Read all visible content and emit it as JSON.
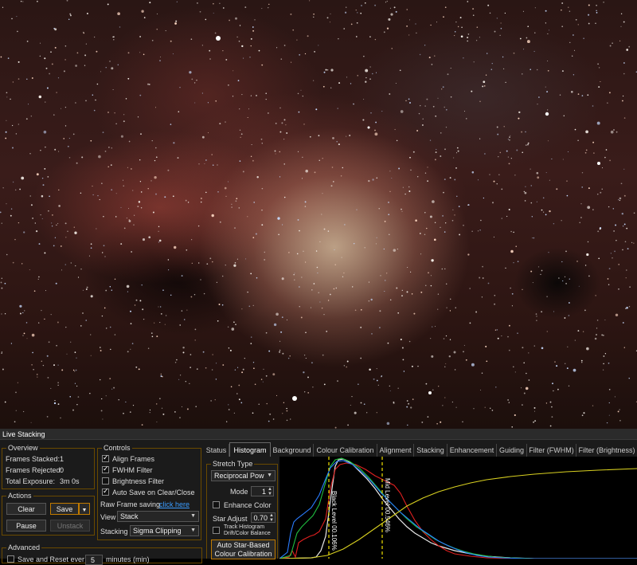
{
  "image": {
    "description_icon": "astro-image"
  },
  "window": {
    "title": "Live Stacking"
  },
  "overview": {
    "title": "Overview",
    "frames_stacked_label": "Frames Stacked:",
    "frames_stacked_value": "1",
    "frames_rejected_label": "Frames Rejected:",
    "frames_rejected_value": "0",
    "total_exposure_label": "Total Exposure:",
    "total_exposure_value": "3m 0s"
  },
  "actions": {
    "title": "Actions",
    "clear": "Clear",
    "save": "Save",
    "pause": "Pause",
    "unstack": "Unstack"
  },
  "advanced": {
    "title": "Advanced",
    "save_reset_label": "Save and Reset ever",
    "save_reset_value": "5",
    "save_reset_suffix": "minutes (min)"
  },
  "controls": {
    "title": "Controls",
    "align_frames": "Align Frames",
    "fwhm_filter": "FWHM Filter",
    "brightness_filter": "Brightness Filter",
    "auto_save": "Auto Save on Clear/Close",
    "raw_frame_label": "Raw Frame saving",
    "raw_frame_link": "click here",
    "view_label": "View",
    "view_value": "Stack",
    "stacking_label": "Stacking",
    "stacking_value": "Sigma Clipping"
  },
  "tabs": [
    "Status",
    "Histogram",
    "Background",
    "Colour Calibration",
    "Alignment",
    "Stacking",
    "Enhancement",
    "Guiding",
    "Filter (FWHM)",
    "Filter (Brightness)"
  ],
  "stretch": {
    "title": "Stretch Type",
    "type_value": "Reciprocal Pow",
    "mode_label": "Mode",
    "mode_value": "1",
    "enhance_color": "Enhance Color",
    "star_adjust_label": "Star Adjust",
    "star_adjust_value": "0.70",
    "track_histogram_line1": "Track Histogram",
    "track_histogram_line2": "Drift/Color Balance",
    "auto_cal_line1": "Auto Star-Based",
    "auto_cal_line2": "Colour Calibration"
  },
  "histogram": {
    "black_level_label": "Black Level 00.106%",
    "mid_level_label": "Mid Level 00.546%"
  },
  "colors": {
    "accent": "#c07a00",
    "link": "#3a9cff",
    "black_marker": "#f0e000",
    "mid_marker": "#f0e000"
  }
}
